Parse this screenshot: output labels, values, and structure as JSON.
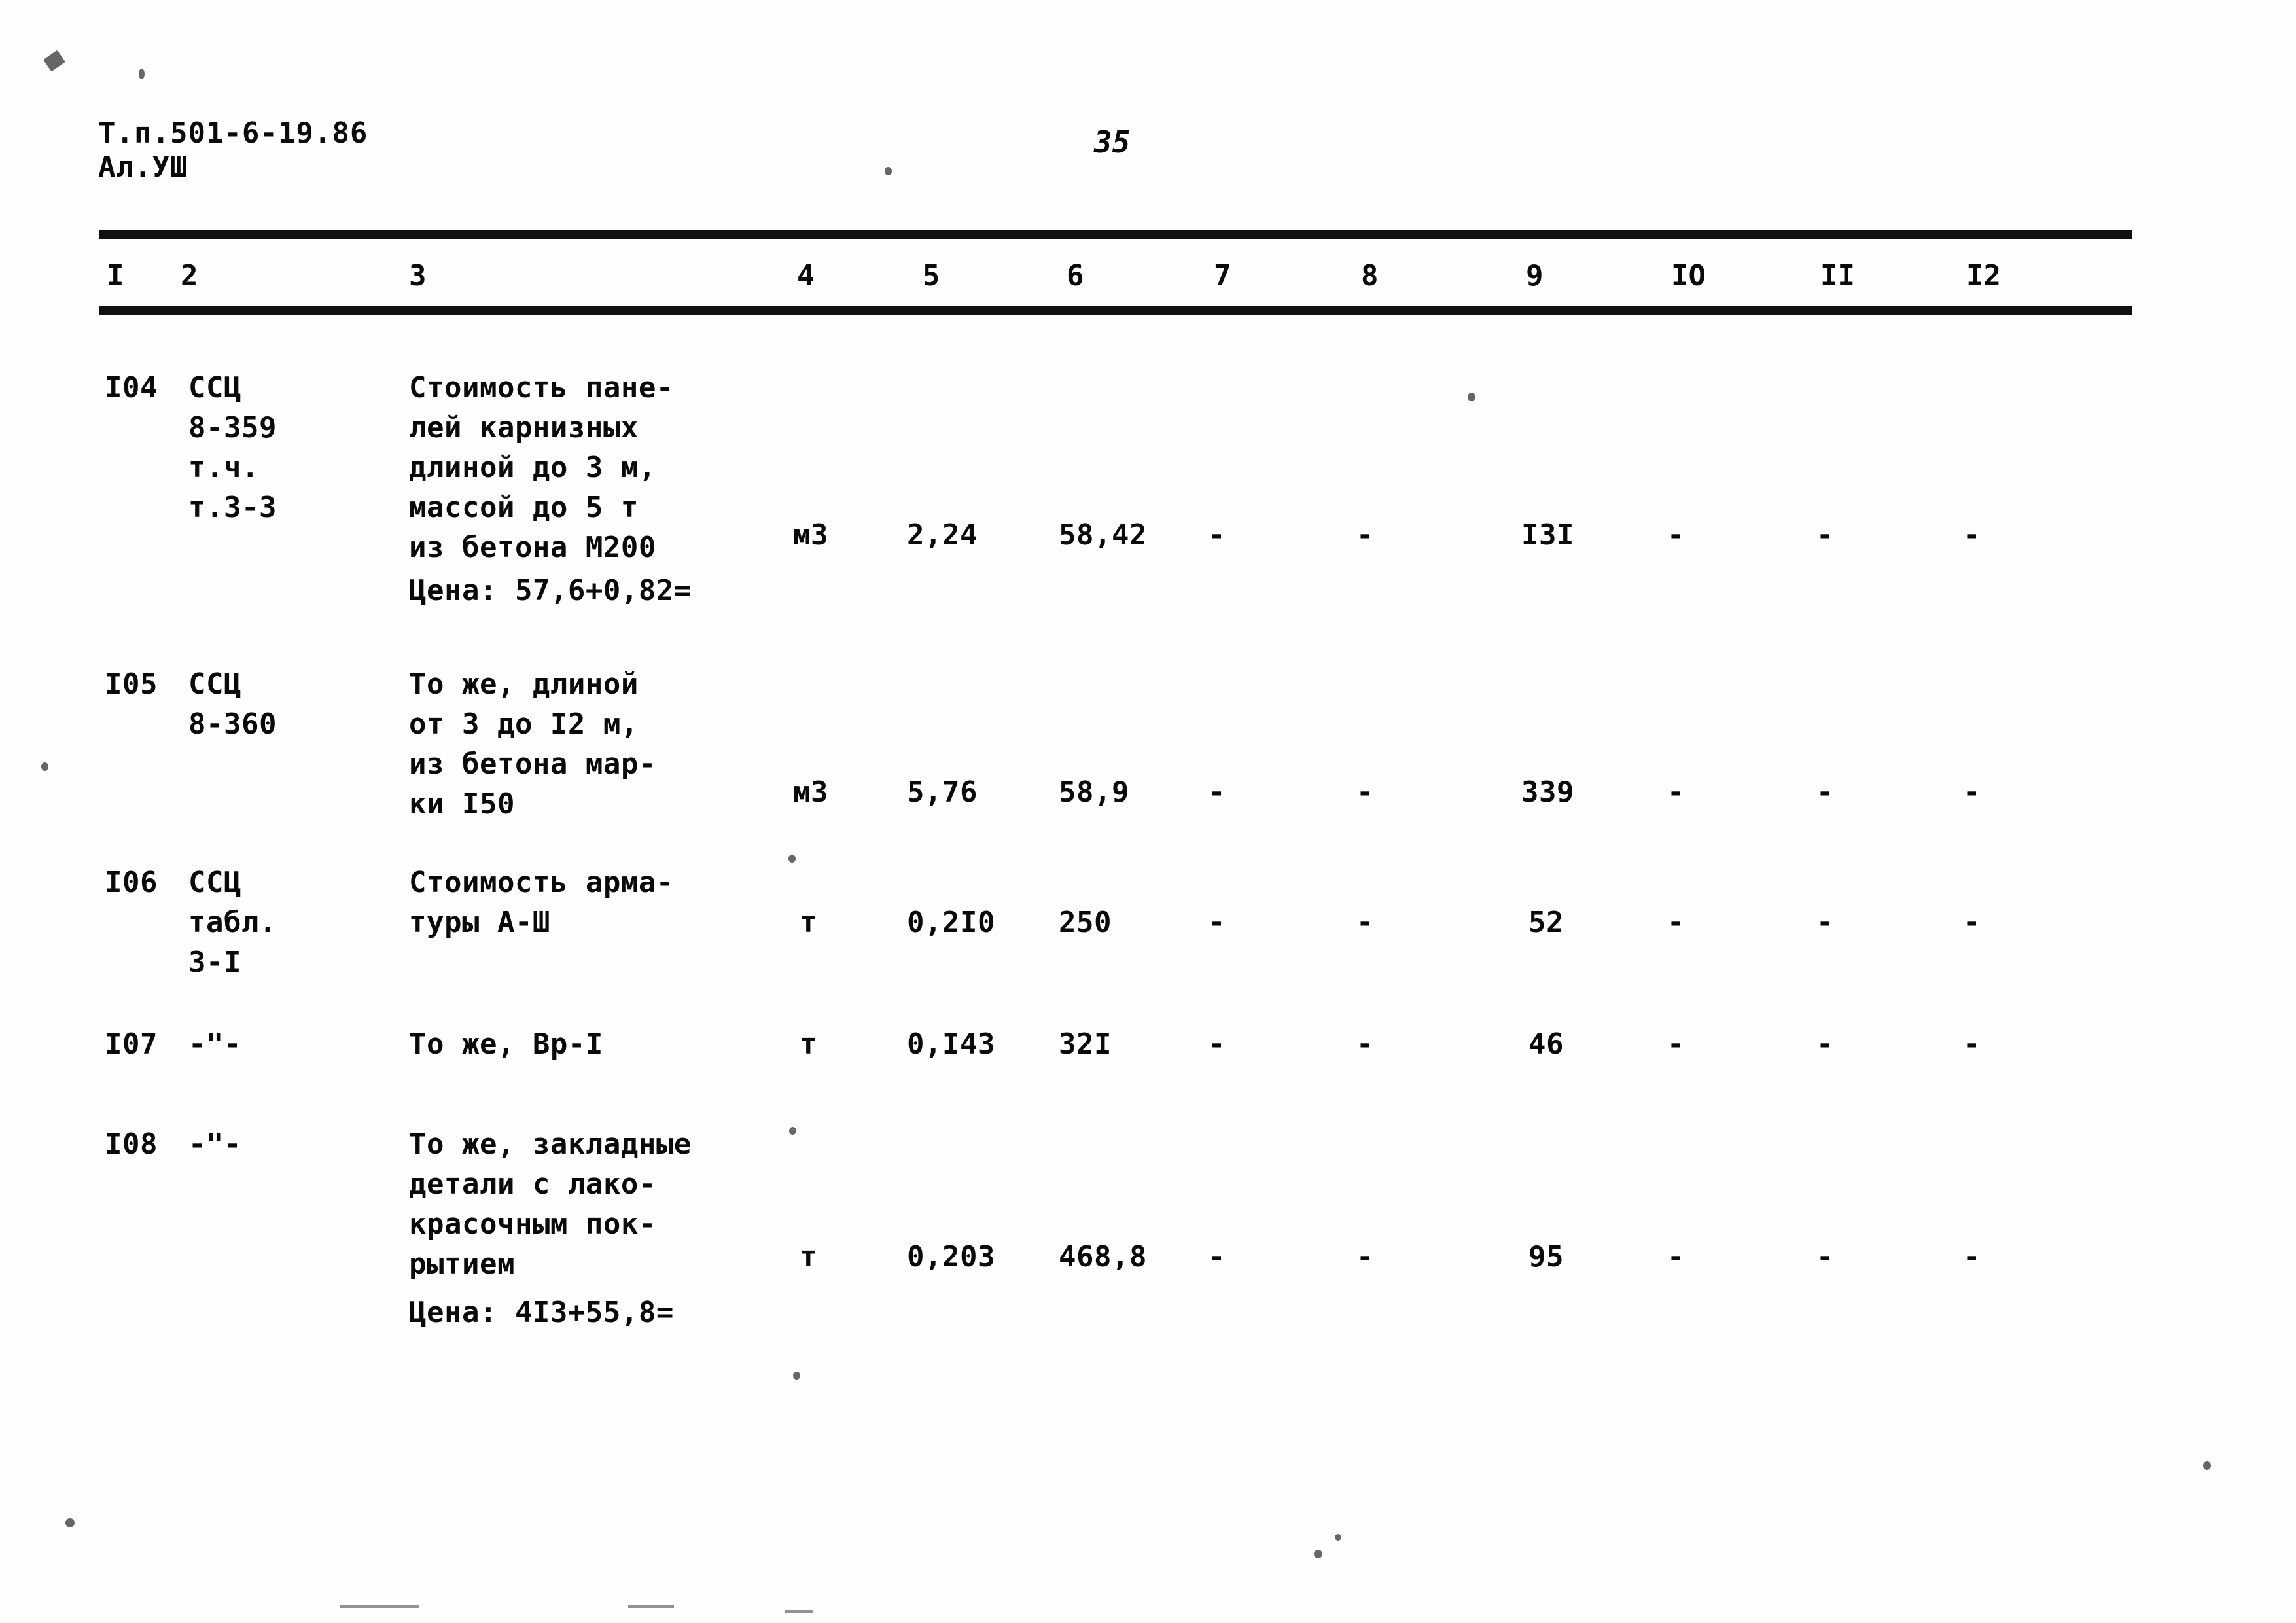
{
  "document": {
    "header_line1": "Т.п.501-6-19.86",
    "header_line2": "Ал.УШ",
    "page_number": "35"
  },
  "table": {
    "column_headers": [
      "I",
      "2",
      "3",
      "4",
      "5",
      "6",
      "7",
      "8",
      "9",
      "IO",
      "II",
      "I2"
    ],
    "rows": [
      {
        "c1": "I04",
        "c2": [
          "ССЦ",
          "8-359",
          "т.ч.",
          "т.3-3"
        ],
        "c3": [
          "Стоимость пане-",
          "лей карнизных",
          "длиной до 3 м,",
          "массой до 5 т",
          "из бетона М200"
        ],
        "c4": "м3",
        "c5": "2,24",
        "c6": "58,42",
        "c7": "-",
        "c8": "-",
        "c9": "I3I",
        "c10": "-",
        "c11": "-",
        "c12": "-",
        "note": "Цена: 57,6+0,82="
      },
      {
        "c1": "I05",
        "c2": [
          "ССЦ",
          "8-360"
        ],
        "c3": [
          "То же, длиной",
          "от 3 до I2 м,",
          "из бетона мар-",
          "ки I50"
        ],
        "c4": "м3",
        "c5": "5,76",
        "c6": "58,9",
        "c7": "-",
        "c8": "-",
        "c9": "339",
        "c10": "-",
        "c11": "-",
        "c12": "-",
        "note": ""
      },
      {
        "c1": "I06",
        "c2": [
          "ССЦ",
          "табл.",
          "3-I"
        ],
        "c3": [
          "Стоимость арма-",
          "туры А-Ш"
        ],
        "c4": "т",
        "c5": "0,2I0",
        "c6": "250",
        "c7": "-",
        "c8": "-",
        "c9": "52",
        "c10": "-",
        "c11": "-",
        "c12": "-",
        "note": ""
      },
      {
        "c1": "I07",
        "c2": [
          "-\"-"
        ],
        "c3": [
          "То же, Вр-I"
        ],
        "c4": "т",
        "c5": "0,I43",
        "c6": "32I",
        "c7": "-",
        "c8": "-",
        "c9": "46",
        "c10": "-",
        "c11": "-",
        "c12": "-",
        "note": ""
      },
      {
        "c1": "I08",
        "c2": [
          "-\"-"
        ],
        "c3": [
          "То же, закладные",
          "детали с лако-",
          "красочным пок-",
          "рытием"
        ],
        "c4": "т",
        "c5": "0,203",
        "c6": "468,8",
        "c7": "-",
        "c8": "-",
        "c9": "95",
        "c10": "-",
        "c11": "-",
        "c12": "-",
        "note": "Цена: 4I3+55,8="
      }
    ]
  }
}
